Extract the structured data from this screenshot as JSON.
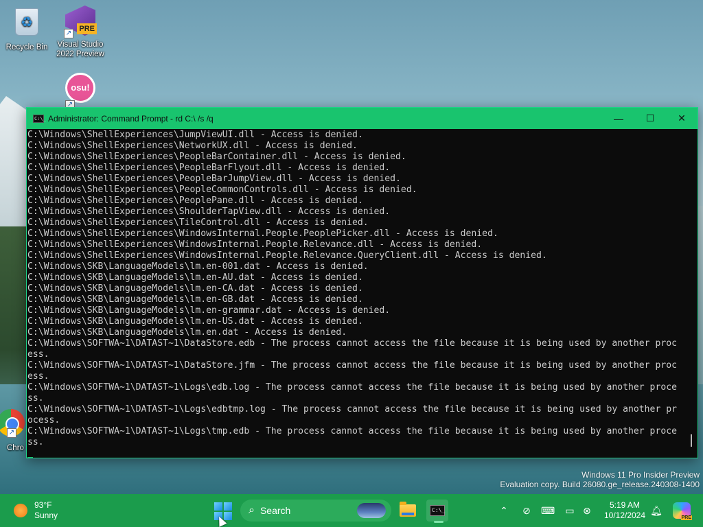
{
  "desktop": {
    "icons": [
      {
        "label": "Recycle Bin"
      },
      {
        "label": "Visual Studio 2022 Preview",
        "badge": "PRE"
      },
      {
        "label": "osu!",
        "glyph": "osu!"
      },
      {
        "label": "Chro"
      }
    ]
  },
  "window": {
    "title": "Administrator: Command Prompt - rd  C:\\ /s /q",
    "icon_text": "C:\\_",
    "controls": {
      "minimize": "—",
      "maximize": "☐",
      "close": "✕"
    }
  },
  "console": {
    "lines": [
      "C:\\Windows\\ShellExperiences\\JumpViewUI.dll - Access is denied.",
      "C:\\Windows\\ShellExperiences\\NetworkUX.dll - Access is denied.",
      "C:\\Windows\\ShellExperiences\\PeopleBarContainer.dll - Access is denied.",
      "C:\\Windows\\ShellExperiences\\PeopleBarFlyout.dll - Access is denied.",
      "C:\\Windows\\ShellExperiences\\PeopleBarJumpView.dll - Access is denied.",
      "C:\\Windows\\ShellExperiences\\PeopleCommonControls.dll - Access is denied.",
      "C:\\Windows\\ShellExperiences\\PeoplePane.dll - Access is denied.",
      "C:\\Windows\\ShellExperiences\\ShoulderTapView.dll - Access is denied.",
      "C:\\Windows\\ShellExperiences\\TileControl.dll - Access is denied.",
      "C:\\Windows\\ShellExperiences\\WindowsInternal.People.PeoplePicker.dll - Access is denied.",
      "C:\\Windows\\ShellExperiences\\WindowsInternal.People.Relevance.dll - Access is denied.",
      "C:\\Windows\\ShellExperiences\\WindowsInternal.People.Relevance.QueryClient.dll - Access is denied.",
      "C:\\Windows\\SKB\\LanguageModels\\lm.en-001.dat - Access is denied.",
      "C:\\Windows\\SKB\\LanguageModels\\lm.en-AU.dat - Access is denied.",
      "C:\\Windows\\SKB\\LanguageModels\\lm.en-CA.dat - Access is denied.",
      "C:\\Windows\\SKB\\LanguageModels\\lm.en-GB.dat - Access is denied.",
      "C:\\Windows\\SKB\\LanguageModels\\lm.en-grammar.dat - Access is denied.",
      "C:\\Windows\\SKB\\LanguageModels\\lm.en-US.dat - Access is denied.",
      "C:\\Windows\\SKB\\LanguageModels\\lm.en.dat - Access is denied.",
      "C:\\Windows\\SOFTWA~1\\DATAST~1\\DataStore.edb - The process cannot access the file because it is being used by another proc",
      "ess.",
      "C:\\Windows\\SOFTWA~1\\DATAST~1\\DataStore.jfm - The process cannot access the file because it is being used by another proc",
      "ess.",
      "C:\\Windows\\SOFTWA~1\\DATAST~1\\Logs\\edb.log - The process cannot access the file because it is being used by another proce",
      "ss.",
      "C:\\Windows\\SOFTWA~1\\DATAST~1\\Logs\\edbtmp.log - The process cannot access the file because it is being used by another pr",
      "ocess.",
      "C:\\Windows\\SOFTWA~1\\DATAST~1\\Logs\\tmp.edb - The process cannot access the file because it is being used by another proce",
      "ss."
    ]
  },
  "watermark": {
    "line1": "Windows 11 Pro Insider Preview",
    "line2": "Evaluation copy. Build 26080.ge_release.240308-1400"
  },
  "taskbar": {
    "weather": {
      "temp": "93°F",
      "condition": "Sunny"
    },
    "search_label": "Search",
    "clock": {
      "time": "5:19 AM",
      "date": "10/12/2024"
    },
    "tray_icons": [
      "chevron-up-icon",
      "network-off-icon",
      "keyboard-icon",
      "display-icon",
      "accessibility-icon",
      "bell-icon"
    ],
    "copilot_badge": "PRE"
  },
  "colors": {
    "accent": "#19c46e",
    "taskbar": "#1b9c4c",
    "console_bg": "#0c0c0c",
    "console_text": "#cccccc"
  }
}
